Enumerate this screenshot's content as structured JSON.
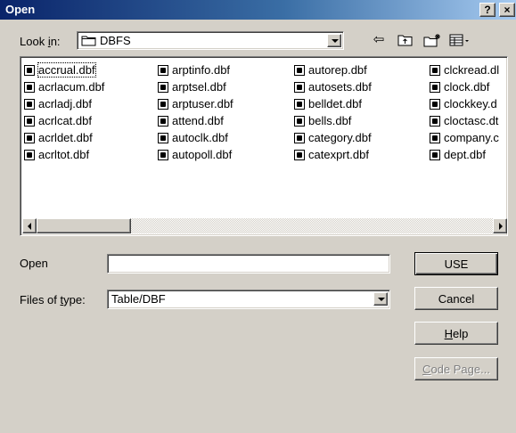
{
  "dialog": {
    "title": "Open",
    "help_button": "?",
    "close_button": "×"
  },
  "look_in": {
    "label_prefix": "Look ",
    "label_hotkey": "i",
    "label_suffix": "n:",
    "value": "DBFS"
  },
  "toolbar": {
    "back_icon": "⇦",
    "up_folder_icon": "⮤",
    "new_folder_icon": "✱",
    "view_menu_icon": "▤▾"
  },
  "files": {
    "columns": [
      [
        "accrual.dbf",
        "acrlacum.dbf",
        "acrladj.dbf",
        "acrlcat.dbf",
        "acrldet.dbf",
        "acrltot.dbf"
      ],
      [
        "arptinfo.dbf",
        "arptsel.dbf",
        "arptuser.dbf",
        "attend.dbf",
        "autoclk.dbf",
        "autopoll.dbf"
      ],
      [
        "autorep.dbf",
        "autosets.dbf",
        "belldet.dbf",
        "bells.dbf",
        "category.dbf",
        "catexprt.dbf"
      ],
      [
        "clckread.dl",
        "clock.dbf",
        "clockkey.d",
        "cloctasc.dt",
        "company.c",
        "dept.dbf"
      ]
    ]
  },
  "open_field": {
    "label": "Open",
    "value": ""
  },
  "file_type": {
    "label_prefix": "Files of ",
    "label_hotkey": "t",
    "label_suffix": "ype:",
    "value": "Table/DBF"
  },
  "buttons": {
    "use": "USE",
    "cancel": "Cancel",
    "help_hotkey": "H",
    "help_rest": "elp",
    "code_page_hotkey": "C",
    "code_page_rest": "ode Page..."
  }
}
